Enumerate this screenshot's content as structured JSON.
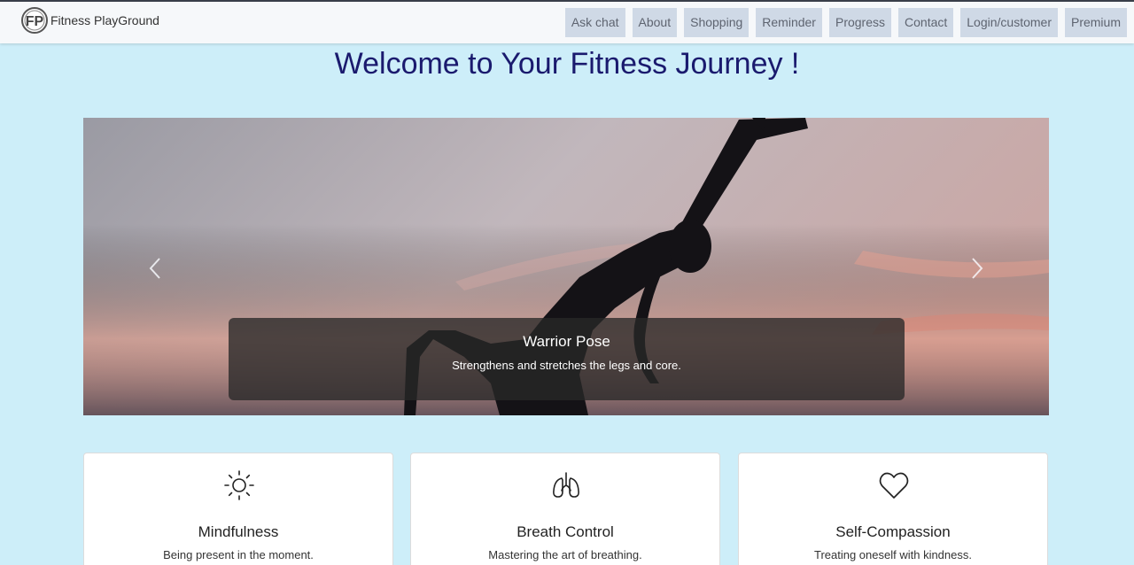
{
  "brand": {
    "name": "Fitness PlayGround",
    "logo_text": "FP",
    "logo_icon": "fp-logo-icon"
  },
  "nav": [
    {
      "label": "Ask chat"
    },
    {
      "label": "About"
    },
    {
      "label": "Shopping"
    },
    {
      "label": "Reminder"
    },
    {
      "label": "Progress"
    },
    {
      "label": "Contact"
    },
    {
      "label": "Login/customer"
    },
    {
      "label": "Premium"
    }
  ],
  "page": {
    "title": "Welcome to Your Fitness Journey !"
  },
  "carousel": {
    "slide_image": "yoga-silhouette-sunset",
    "caption_title": "Warrior Pose",
    "caption_text": "Strengthens and stretches the legs and core.",
    "prev_icon": "chevron-left-icon",
    "next_icon": "chevron-right-icon"
  },
  "cards": [
    {
      "icon": "sun-icon",
      "title": "Mindfulness",
      "text": "Being present in the moment."
    },
    {
      "icon": "lungs-icon",
      "title": "Breath Control",
      "text": "Mastering the art of breathing."
    },
    {
      "icon": "heart-icon",
      "title": "Self-Compassion",
      "text": "Treating oneself with kindness."
    }
  ],
  "colors": {
    "background": "#cdeef9",
    "title": "#1a1a6e",
    "nav_item_bg": "#cfd9e6"
  }
}
